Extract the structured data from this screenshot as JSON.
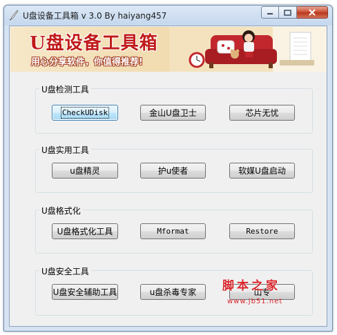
{
  "window": {
    "title": "U盘设备工具箱 v  3.0  By haiyang457",
    "icon": "quill-pen-icon"
  },
  "banner": {
    "title": "U盘设备工具箱",
    "slogan": "用心分享软件，你值得推荐!"
  },
  "groups": [
    {
      "label": "U盘检测工具",
      "buttons": [
        "CheckUDisk",
        "金山U盘卫士",
        "芯片无忧"
      ]
    },
    {
      "label": "U盘实用工具",
      "buttons": [
        "u盘精灵",
        "护u使者",
        "软媒U盘启动"
      ]
    },
    {
      "label": "U盘格式化",
      "buttons": [
        "U盘格式化工具",
        "Mformat",
        "Restore"
      ]
    },
    {
      "label": "U盘安全工具",
      "buttons": [
        "U盘安全辅助工具",
        "u盘杀毒专家",
        "山专"
      ]
    }
  ],
  "watermark": {
    "text": "脚本之家",
    "url": "www.jb51.net"
  },
  "colors": {
    "title_red": "#c01a1a",
    "watermark_red": "#d8262c",
    "close_red": "#c74a2e"
  }
}
